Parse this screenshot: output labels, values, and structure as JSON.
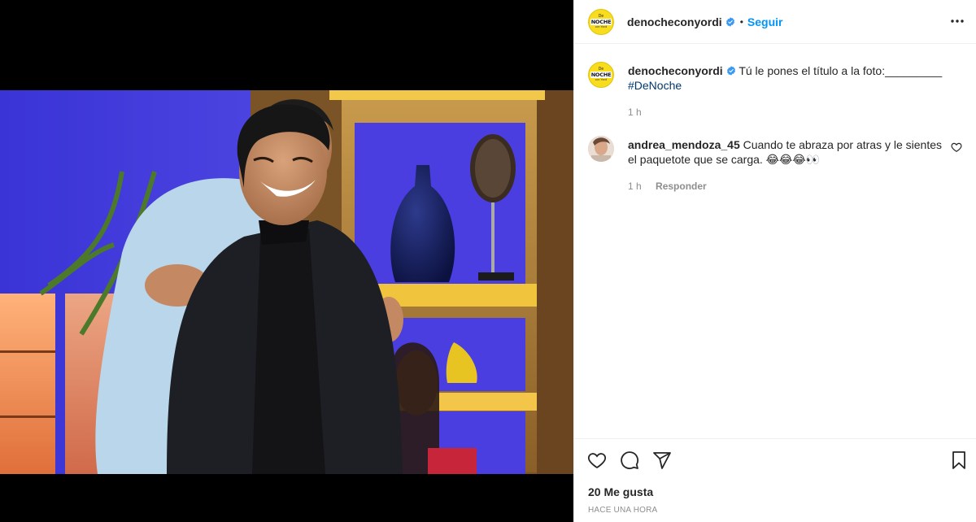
{
  "post": {
    "username": "denocheconyordi",
    "follow_label": "Seguir",
    "separator": "•",
    "brand_avatar": {
      "top": "De",
      "logo": "NOCHE",
      "bottom": "con Yordi"
    },
    "caption_text": "Tú le pones el título a la foto:_________",
    "hashtag": "#DeNoche",
    "caption_time": "1 h",
    "likes": "20 Me gusta",
    "timestamp": "HACE UNA HORA"
  },
  "comments": [
    {
      "username": "andrea_mendoza_45",
      "text": "Cuando te abraza por atras y le sientes el paquetote que se carga. 😂😂😂👀",
      "time": "1 h",
      "reply_label": "Responder"
    }
  ],
  "icons": {
    "more": "more-options-icon",
    "verified": "verified-badge-icon",
    "like": "heart-icon",
    "comment": "comment-icon",
    "share": "share-icon",
    "save": "bookmark-icon"
  },
  "colors": {
    "accent": "#0095f6",
    "hashtag": "#00376b",
    "muted": "#8e8e8e",
    "brand_yellow": "#f8dc1e"
  }
}
